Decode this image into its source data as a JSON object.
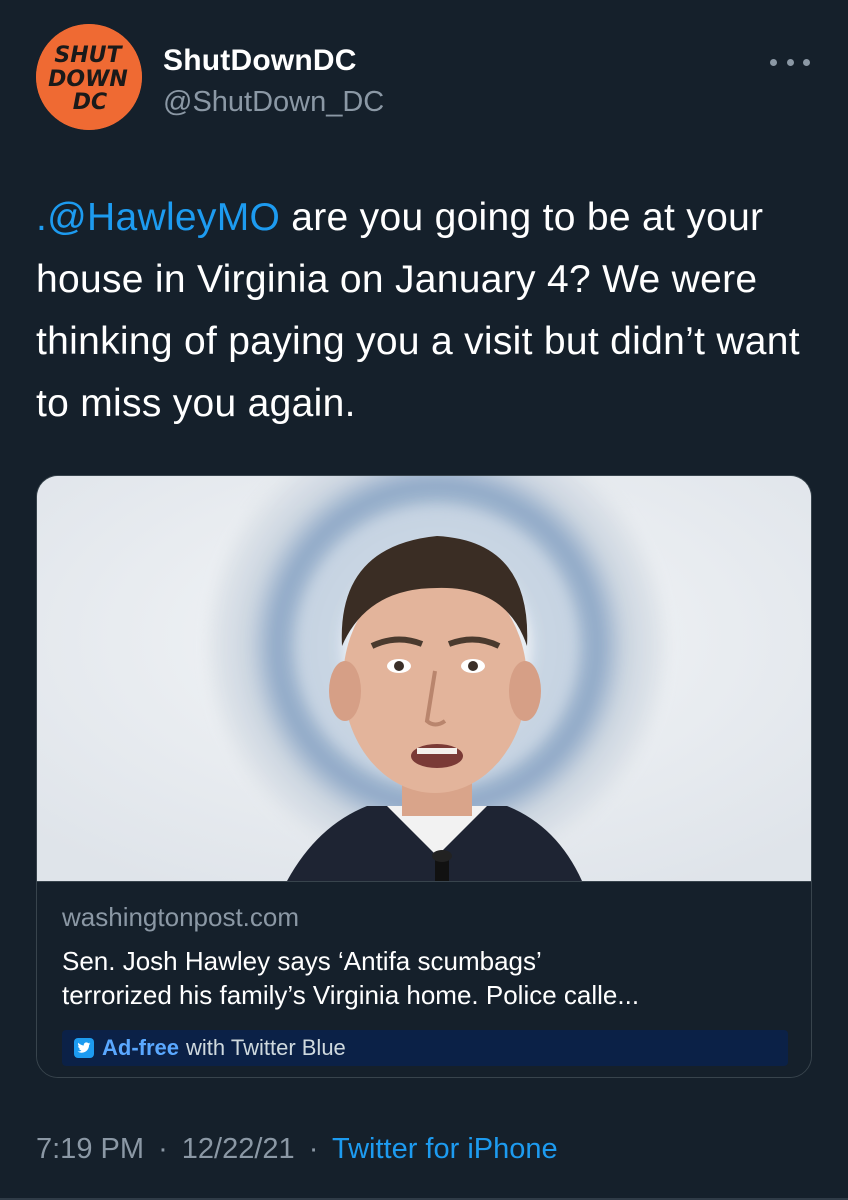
{
  "author": {
    "display_name": "ShutDownDC",
    "handle": "@ShutDown_DC",
    "avatar_lines": [
      "SHUT",
      "DOWN",
      "DC"
    ],
    "avatar_color": "#ef6a33"
  },
  "more_icon": "more-horizontal-icon",
  "tweet": {
    "mention": ".@HawleyMO",
    "text_rest": " are you going to be at your house in Virginia on January 4? We were thinking of paying you a visit but didn’t want to miss you again."
  },
  "card": {
    "domain": "washingtonpost.com",
    "title_line1": "Sen. Josh Hawley says ‘Antifa scumbags’",
    "title_line2": "terrorized his family’s Virginia home. Police calle...",
    "adfree_strong": "Ad-free",
    "adfree_rest": "with Twitter Blue"
  },
  "footer": {
    "time": "7:19 PM",
    "sep1": "·",
    "date": "12/22/21",
    "sep2": "·",
    "source": "Twitter for iPhone"
  },
  "colors": {
    "background": "#15202b",
    "link": "#1d9bf0",
    "secondary_text": "#8b98a5"
  }
}
